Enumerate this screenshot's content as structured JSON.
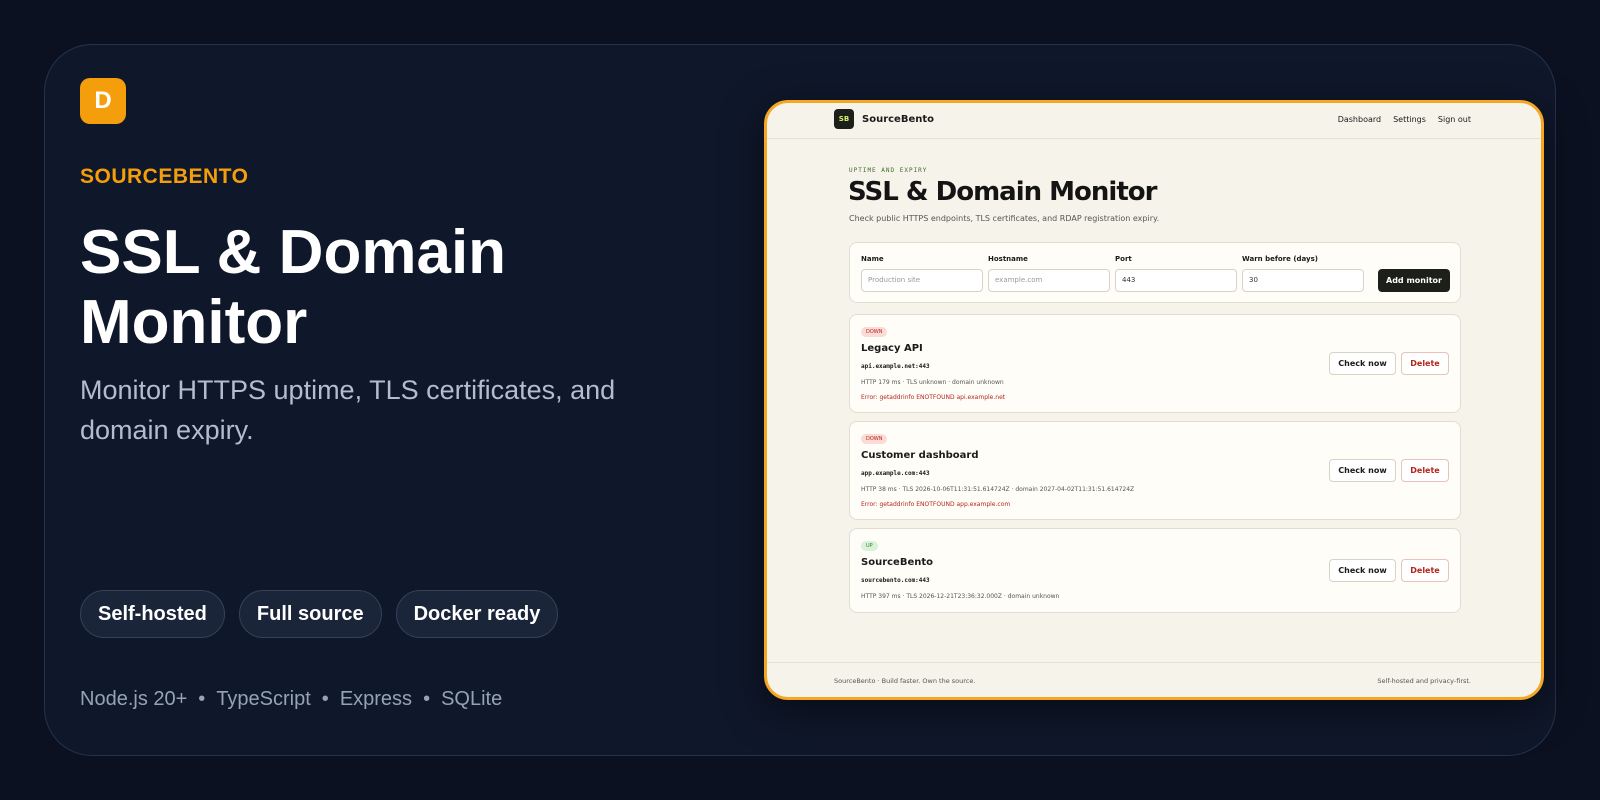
{
  "hero": {
    "logo_letter": "D",
    "brand": "SOURCEBENTO",
    "title": "SSL & Domain Monitor",
    "subtitle": "Monitor HTTPS uptime, TLS certificates, and domain expiry.",
    "pills": [
      "Self-hosted",
      "Full source",
      "Docker ready"
    ],
    "tech": [
      "Node.js 20+",
      "TypeScript",
      "Express",
      "SQLite"
    ],
    "tech_separator": "•"
  },
  "app": {
    "logo": "SB",
    "brand": "SourceBento",
    "nav": [
      "Dashboard",
      "Settings",
      "Sign out"
    ],
    "eyebrow": "UPTIME AND EXPIRY",
    "title": "SSL & Domain Monitor",
    "subtitle": "Check public HTTPS endpoints, TLS certificates, and RDAP registration expiry.",
    "form": {
      "name_label": "Name",
      "name_placeholder": "Production site",
      "hostname_label": "Hostname",
      "hostname_placeholder": "example.com",
      "port_label": "Port",
      "port_value": "443",
      "warn_label": "Warn before (days)",
      "warn_value": "30",
      "add_button": "Add monitor"
    },
    "monitors": [
      {
        "status": "DOWN",
        "name": "Legacy API",
        "host": "api.example.net:443",
        "stats": "HTTP 179 ms · TLS unknown · domain unknown",
        "error": "Error: getaddrinfo ENOTFOUND api.example.net",
        "check_label": "Check now",
        "delete_label": "Delete"
      },
      {
        "status": "DOWN",
        "name": "Customer dashboard",
        "host": "app.example.com:443",
        "stats": "HTTP 38 ms · TLS 2026-10-06T11:31:51.614724Z · domain 2027-04-02T11:31:51.614724Z",
        "error": "Error: getaddrinfo ENOTFOUND app.example.com",
        "check_label": "Check now",
        "delete_label": "Delete"
      },
      {
        "status": "UP",
        "name": "SourceBento",
        "host": "sourcebento.com:443",
        "stats": "HTTP 397 ms · TLS 2026-12-21T23:36:32.000Z · domain unknown",
        "check_label": "Check now",
        "delete_label": "Delete"
      }
    ],
    "footer_left": "SourceBento · Build faster. Own the source.",
    "footer_right": "Self-hosted and privacy-first."
  },
  "colors": {
    "accent": "#f59e0b",
    "background": "#0b1120",
    "card": "#0f172a",
    "app_bg": "#f6f3ea",
    "down": "#b3261e",
    "up": "#2e7d32"
  }
}
